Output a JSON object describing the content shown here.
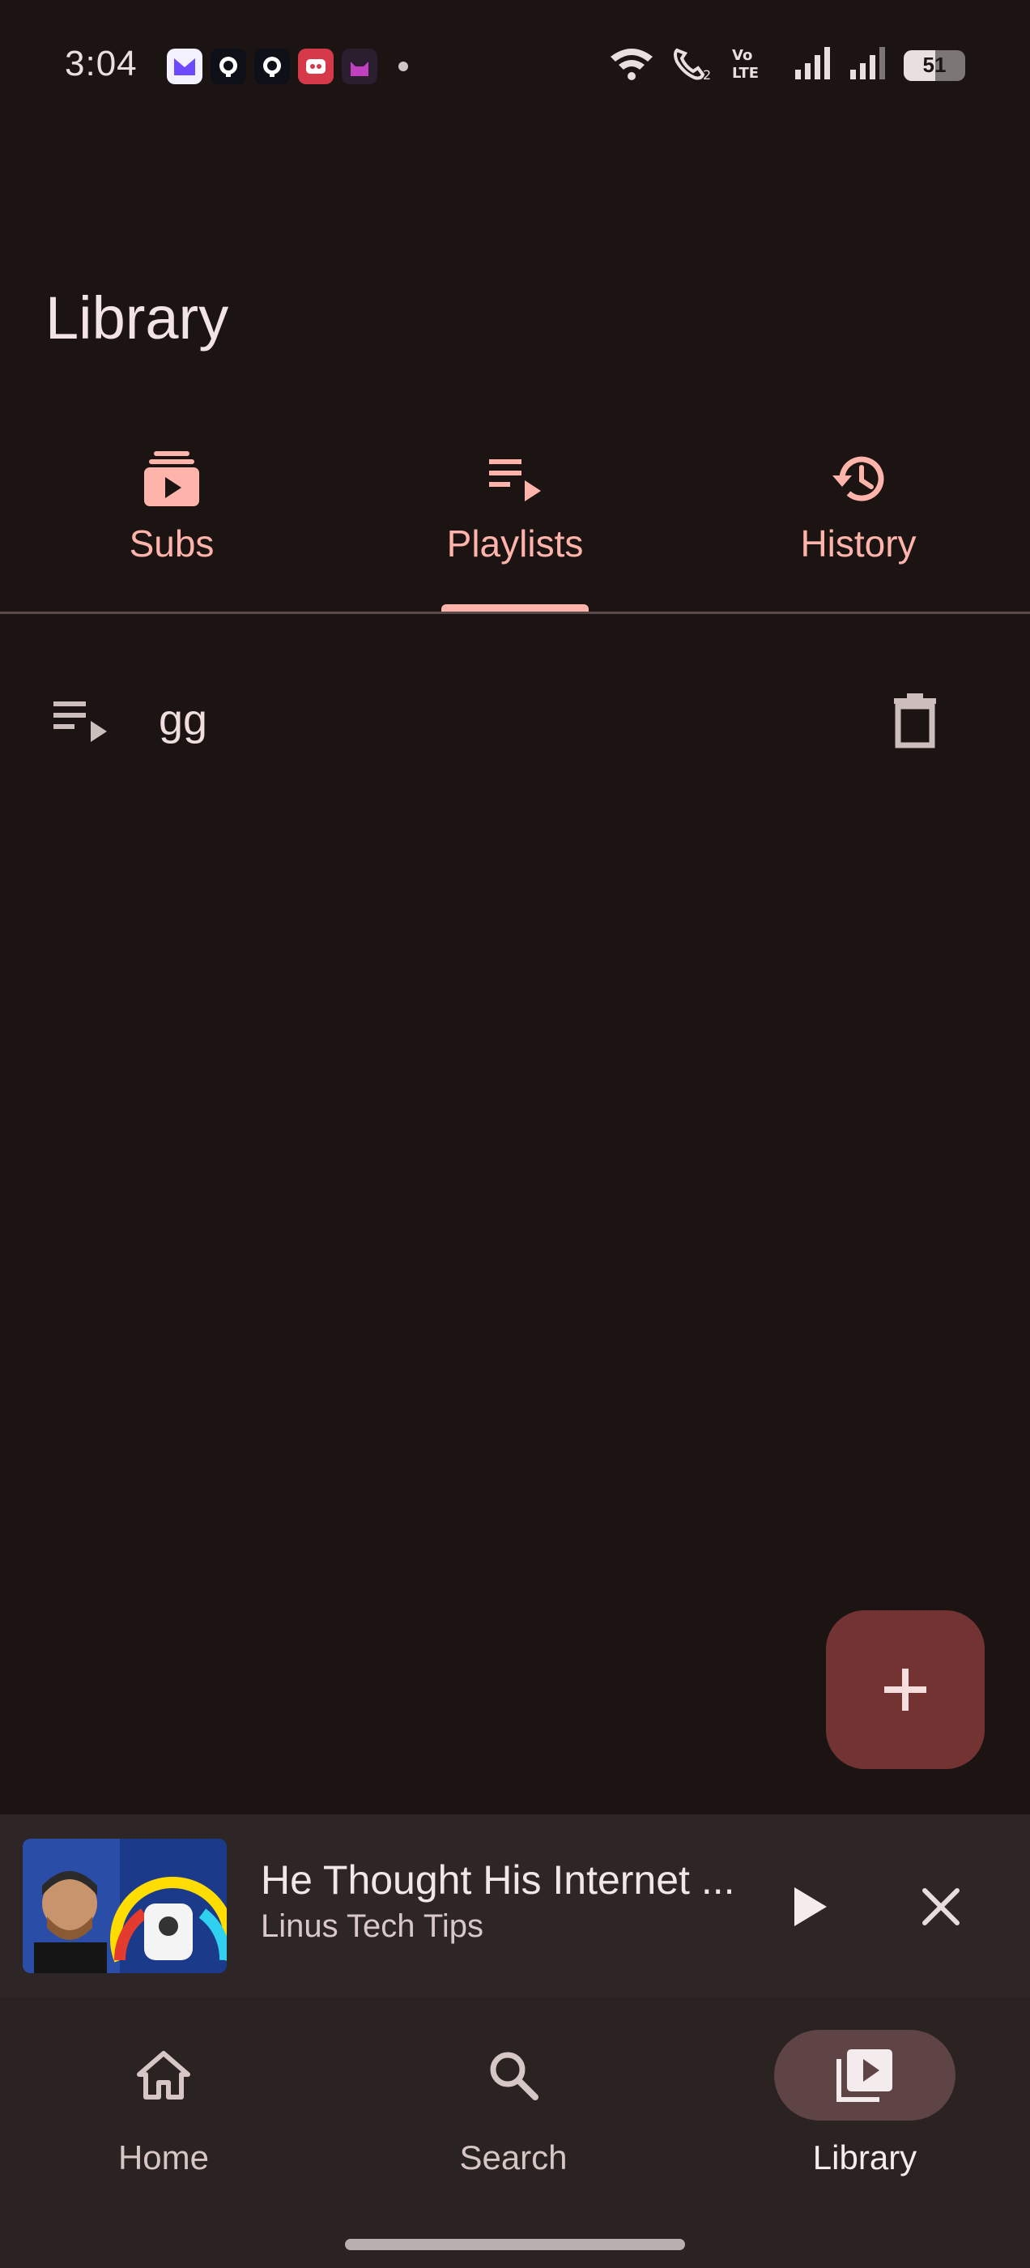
{
  "status_bar": {
    "time": "3:04",
    "notification_icons": [
      "proton-mail-icon",
      "github-icon",
      "github-icon",
      "red-app-icon",
      "cat-app-icon"
    ],
    "battery": "51"
  },
  "page": {
    "title": "Library"
  },
  "tabs": [
    {
      "label": "Subs",
      "icon": "subscriptions-icon",
      "selected": false
    },
    {
      "label": "Playlists",
      "icon": "playlist-play-icon",
      "selected": true
    },
    {
      "label": "History",
      "icon": "history-icon",
      "selected": false
    }
  ],
  "playlists": [
    {
      "name": "gg",
      "icon": "playlist-play-icon",
      "action_icon": "delete-icon"
    }
  ],
  "fab": {
    "icon": "add-icon"
  },
  "mini_player": {
    "title": "He Thought His Internet ...",
    "artist": "Linus Tech Tips",
    "play_icon": "play-icon",
    "close_icon": "close-icon"
  },
  "bottom_nav": [
    {
      "label": "Home",
      "icon": "home-icon",
      "selected": false
    },
    {
      "label": "Search",
      "icon": "search-icon",
      "selected": false
    },
    {
      "label": "Library",
      "icon": "video-library-icon",
      "selected": true
    }
  ],
  "colors": {
    "background": "#1c1313",
    "accent": "#ffb4ab",
    "fab": "#733333",
    "nav_active_pill": "#5e4444"
  }
}
